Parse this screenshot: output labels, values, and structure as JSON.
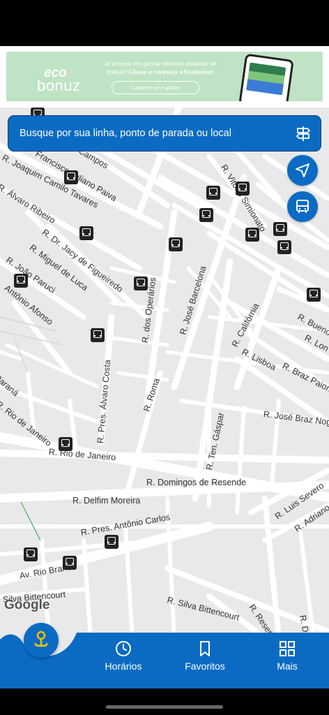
{
  "ad": {
    "logo_eco": "eco",
    "logo_bonuz": "bonuz",
    "line1": "Já pensou em ganhar dinheiro andando de",
    "line2_plain": "ônibus?",
    "line2_bold": "Clique e conheça a Ecobonuz!",
    "cta": "Cadastre-se e ganhe"
  },
  "search": {
    "placeholder": "Busque por sua linha, ponto de parada ou local",
    "sign_icon": "bus-stop-sign-icon"
  },
  "fabs": [
    {
      "icon": "navigation-arrow-icon"
    },
    {
      "icon": "bus-icon"
    }
  ],
  "map": {
    "attribution": "Google",
    "streets": [
      "R. Joaquim Camilo Tavares",
      "Francisco Juliano Paiva",
      "R. Álvaro Ribeiro",
      "R. Dr. Jacy de Figueiredo",
      "R. Miguel de Luca",
      "R. João Paruci",
      "Antônio Afonso",
      "R. Vitório Simionato",
      "R. José Barcelona",
      "R. dos Operários",
      "R. Califórnia",
      "R. Lisboa",
      "R. Braz Paione",
      "R. Buenos",
      "R. Lon",
      "R. Roma",
      "R. José Braz Nog",
      "R. Pres. Álvaro Costa",
      "R. Ten. Gáspar",
      "R. Rio de Janeiro",
      "R. Rio de Janeiro",
      "R. Domingos de Resende",
      "R. Delfim Moreira",
      "R. Luis Severo",
      "R. Adriano",
      "R. Pres. Antônio Carlos",
      "Av. Rio Branco",
      "Silva Bittencourt",
      "R. Silva Bittencourt",
      "R. Resende",
      "R. D",
      "Paraná",
      "R. Campos"
    ]
  },
  "nav": {
    "center_icon": "location-pin-icon",
    "items": [
      {
        "label": "Horários",
        "icon": "clock-icon"
      },
      {
        "label": "Favoritos",
        "icon": "bookmark-icon"
      },
      {
        "label": "Mais",
        "icon": "grid-icon"
      }
    ]
  },
  "colors": {
    "primary": "#0b6bc2",
    "map_bg": "#e9e9ec",
    "ad_bg": "#bfe3c4"
  }
}
